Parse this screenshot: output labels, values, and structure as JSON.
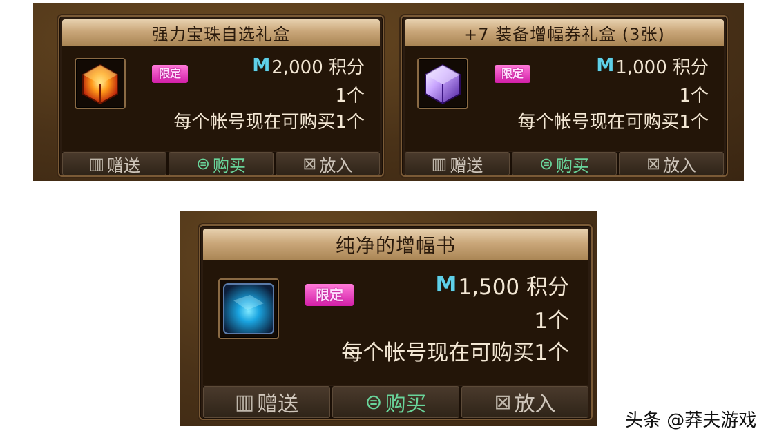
{
  "cards": [
    {
      "title": "强力宝珠自选礼盒",
      "badge": "限定",
      "currency_icon": "M",
      "price": "2,000 积分",
      "quantity": "1个",
      "limit": "每个帐号现在可购买1个",
      "icon_name": "orange-gem-box-icon",
      "buttons": {
        "gift": "赠送",
        "buy": "购买",
        "cart": "放入"
      }
    },
    {
      "title": "+7 装备增幅券礼盒 (3张)",
      "badge": "限定",
      "currency_icon": "M",
      "price": "1,000 积分",
      "quantity": "1个",
      "limit": "每个帐号现在可购买1个",
      "icon_name": "purple-cube-box-icon",
      "buttons": {
        "gift": "赠送",
        "buy": "购买",
        "cart": "放入"
      }
    },
    {
      "title": "纯净的增幅书",
      "badge": "限定",
      "currency_icon": "M",
      "price": "1,500 积分",
      "quantity": "1个",
      "limit": "每个帐号现在可购买1个",
      "icon_name": "blue-book-icon",
      "buttons": {
        "gift": "赠送",
        "buy": "购买",
        "cart": "放入"
      }
    }
  ],
  "watermark": "头条 @莽夫游戏",
  "colors": {
    "panel_bg": "#4a3218",
    "card_bg": "#231508",
    "title_bar": "#caa77a",
    "badge": "#e03cbf",
    "currency": "#5fd0e8",
    "buy_button": "#69d49a"
  }
}
